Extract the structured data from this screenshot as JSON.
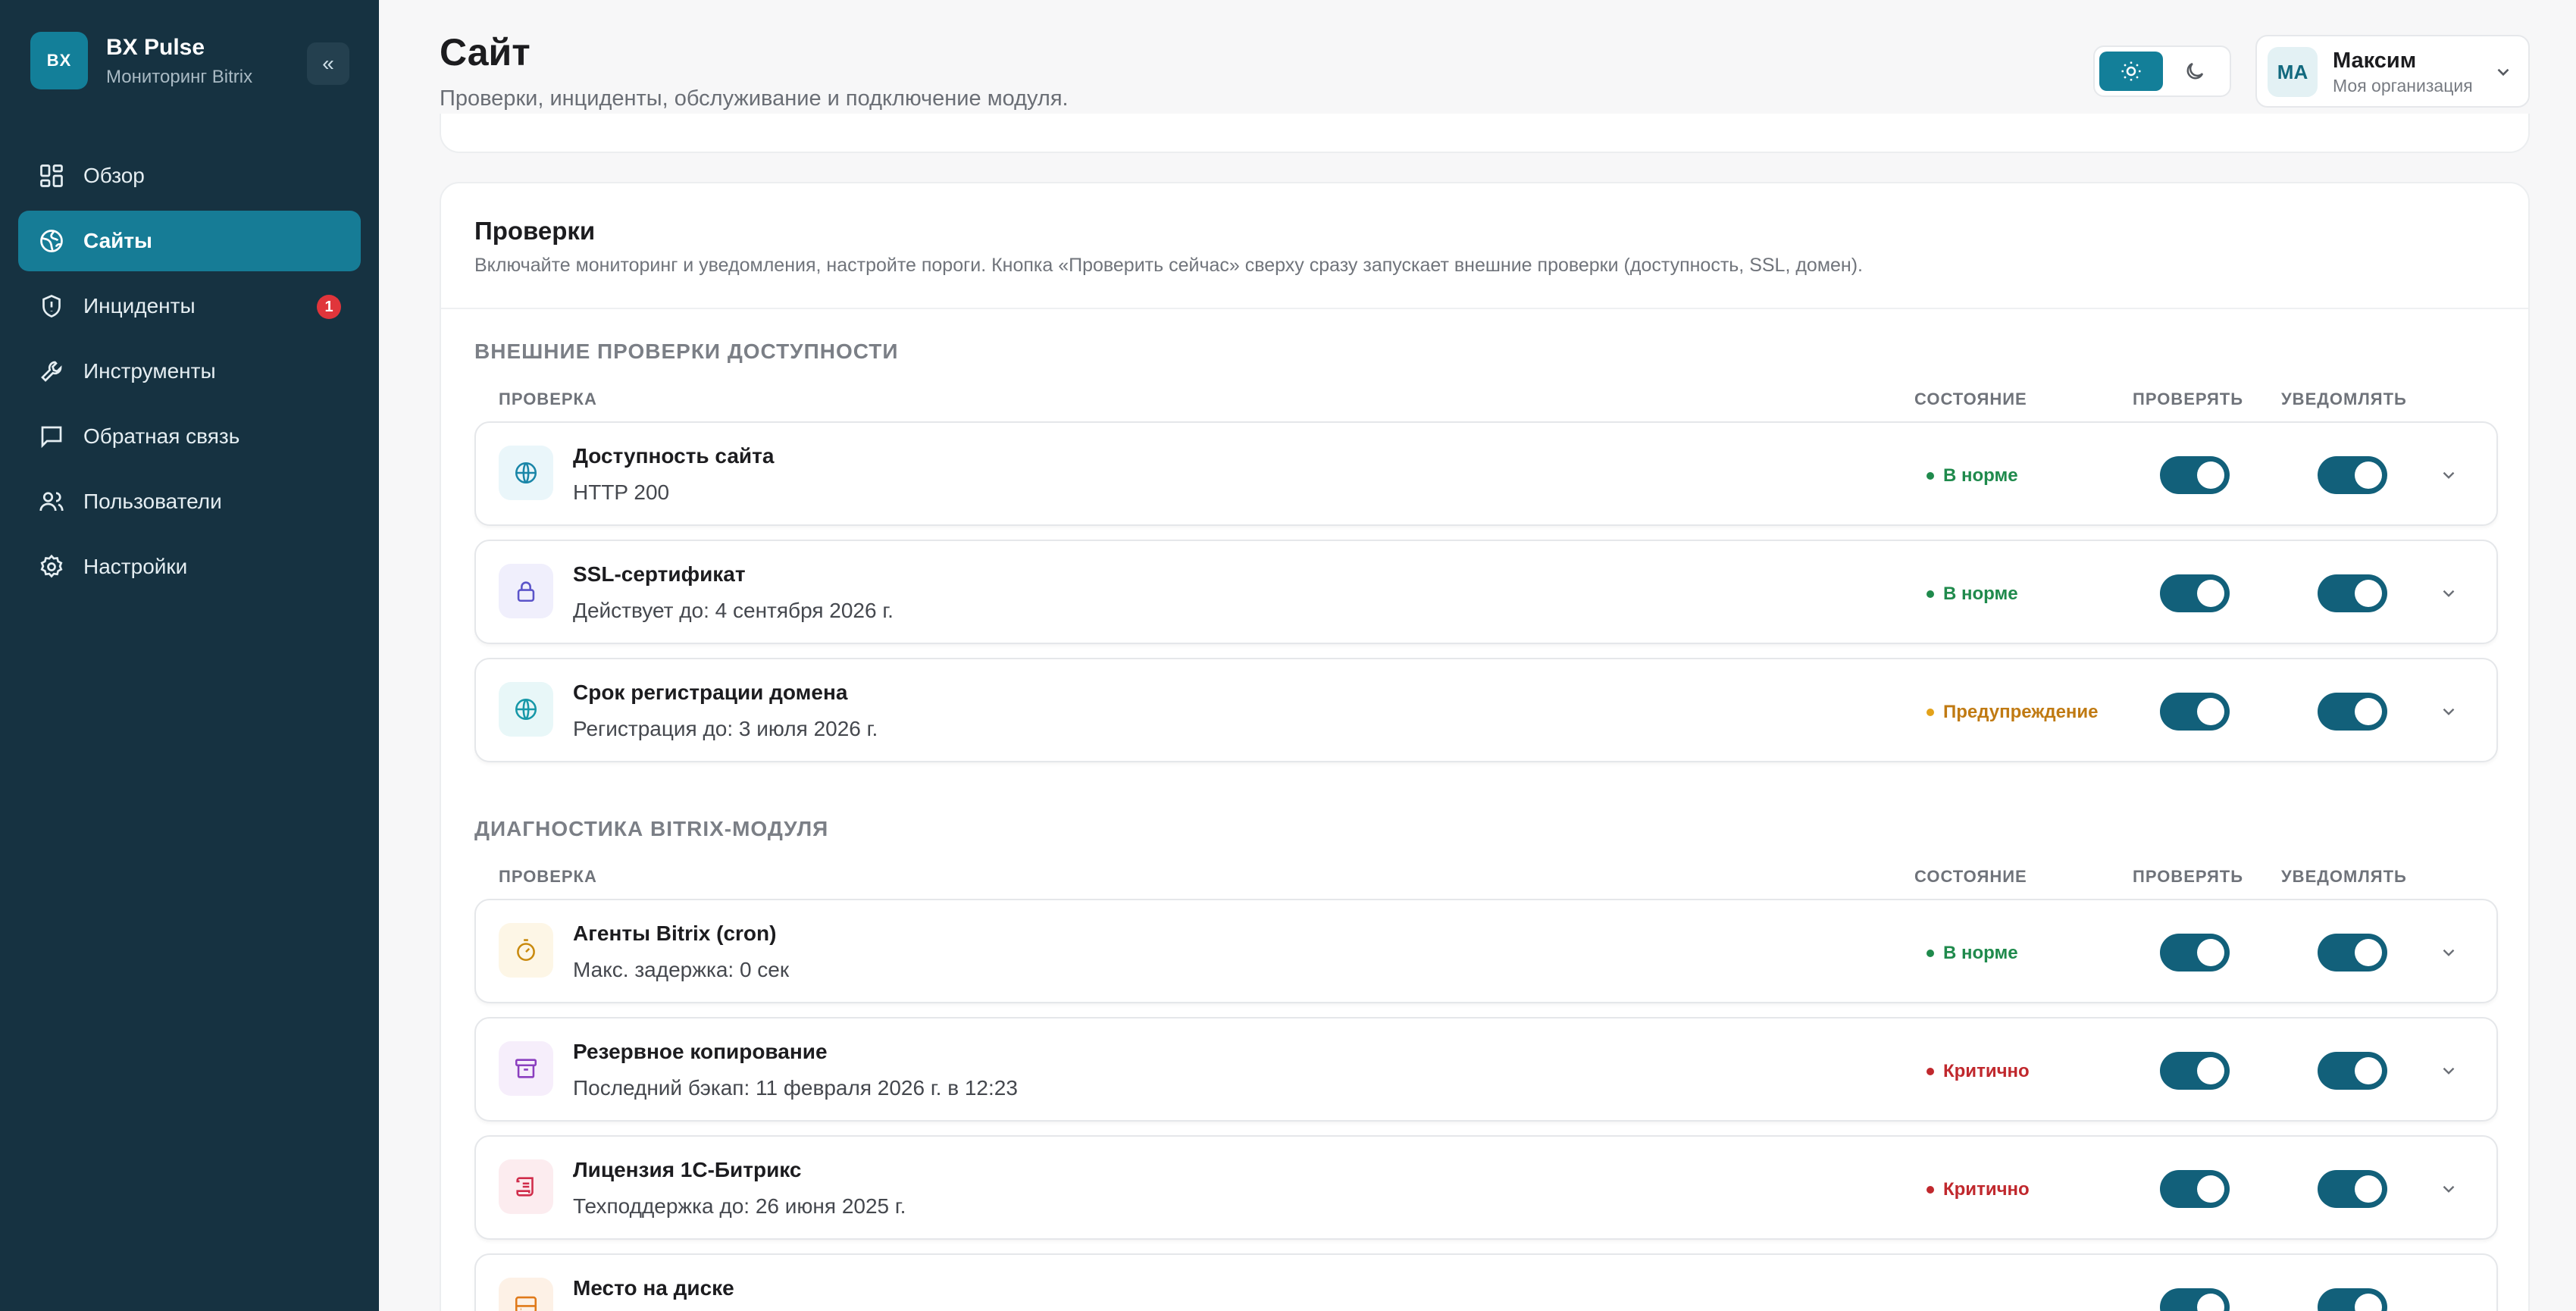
{
  "brand": {
    "logo_text": "BX",
    "name": "BX Pulse",
    "subtitle": "Мониторинг Bitrix",
    "collapse_glyph": "«"
  },
  "nav": [
    {
      "label": "Обзор",
      "icon": "dashboard-icon"
    },
    {
      "label": "Сайты",
      "icon": "globe-icon",
      "active": true
    },
    {
      "label": "Инциденты",
      "icon": "shield-icon",
      "badge": "1"
    },
    {
      "label": "Инструменты",
      "icon": "wrench-icon"
    },
    {
      "label": "Обратная связь",
      "icon": "message-icon"
    },
    {
      "label": "Пользователи",
      "icon": "users-icon"
    },
    {
      "label": "Настройки",
      "icon": "gear-icon"
    }
  ],
  "header": {
    "title": "Сайт",
    "subtitle": "Проверки, инциденты, обслуживание и подключение модуля.",
    "theme": {
      "light_icon": "sun-icon",
      "dark_icon": "moon-icon",
      "selected": "light"
    },
    "user": {
      "initials": "МА",
      "name": "Максим",
      "org": "Моя организация"
    }
  },
  "card": {
    "title": "Проверки",
    "subtitle": "Включайте мониторинг и уведомления, настройте пороги. Кнопка «Проверить сейчас» сверху сразу запускает внешние проверки (доступность, SSL, домен).",
    "columns": {
      "check": "ПРОВЕРКА",
      "state": "СОСТОЯНИЕ",
      "verify": "ПРОВЕРЯТЬ",
      "notify": "УВЕДОМЛЯТЬ"
    },
    "sections": [
      {
        "title": "ВНЕШНИЕ ПРОВЕРКИ ДОСТУПНОСТИ",
        "rows": [
          {
            "name": "Доступность сайта",
            "detail": "HTTP 200",
            "status": "В норме",
            "status_color": "#1f8a4c",
            "icon": "globe-icon",
            "icon_color": "#1a86a8",
            "icon_bg": "#eaf6fa",
            "check_on": true,
            "notify_on": true
          },
          {
            "name": "SSL-сертификат",
            "detail": "Действует до: 4 сентября 2026 г.",
            "status": "В норме",
            "status_color": "#1f8a4c",
            "icon": "lock-icon",
            "icon_color": "#5b54c9",
            "icon_bg": "#f0effc",
            "check_on": true,
            "notify_on": true
          },
          {
            "name": "Срок регистрации домена",
            "detail": "Регистрация до: 3 июля 2026 г.",
            "status": "Предупреждение",
            "status_color": "#c07a12",
            "icon": "globe-icon",
            "icon_color": "#1798a8",
            "icon_bg": "#e8f7f8",
            "check_on": true,
            "notify_on": true
          }
        ]
      },
      {
        "title": "ДИАГНОСТИКА BITRIX-МОДУЛЯ",
        "rows": [
          {
            "name": "Агенты Bitrix (cron)",
            "detail": "Макс. задержка: 0 сек",
            "status": "В норме",
            "status_color": "#1f8a4c",
            "icon": "timer-icon",
            "icon_color": "#c98a0e",
            "icon_bg": "#fdf6e6",
            "check_on": true,
            "notify_on": true
          },
          {
            "name": "Резервное копирование",
            "detail": "Последний бэкап: 11 февраля 2026 г. в 12:23",
            "status": "Критично",
            "status_color": "#c0282d",
            "icon": "archive-icon",
            "icon_color": "#8b3fbf",
            "icon_bg": "#f6eefb",
            "check_on": true,
            "notify_on": true
          },
          {
            "name": "Лицензия 1С-Битрикс",
            "detail": "Техподдержка до: 26 июня 2025 г.",
            "status": "Критично",
            "status_color": "#c0282d",
            "icon": "scroll-icon",
            "icon_color": "#d02c4a",
            "icon_bg": "#fcecef",
            "check_on": true,
            "notify_on": true
          },
          {
            "name": "Место на диске",
            "detail": "",
            "status": "",
            "status_color": "#1f8a4c",
            "icon": "disk-icon",
            "icon_color": "#e07a1a",
            "icon_bg": "#fdf1e6",
            "check_on": true,
            "notify_on": true
          }
        ]
      }
    ]
  }
}
